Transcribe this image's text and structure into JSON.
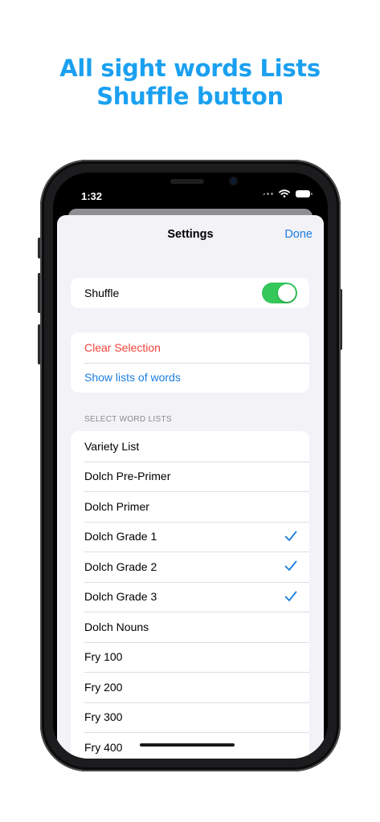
{
  "promo": {
    "line1": "All sight words Lists",
    "line2": "Shuffle button"
  },
  "status_bar": {
    "time": "1:32"
  },
  "settings": {
    "title": "Settings",
    "done_label": "Done",
    "shuffle": {
      "label": "Shuffle",
      "on": true
    },
    "actions": {
      "clear_selection": "Clear Selection",
      "show_lists": "Show lists of words"
    },
    "section_header": "SELECT WORD LISTS",
    "word_lists": [
      {
        "label": "Variety List",
        "checked": false
      },
      {
        "label": "Dolch Pre-Primer",
        "checked": false
      },
      {
        "label": "Dolch Primer",
        "checked": false
      },
      {
        "label": "Dolch Grade 1",
        "checked": true
      },
      {
        "label": "Dolch Grade 2",
        "checked": true
      },
      {
        "label": "Dolch Grade 3",
        "checked": true
      },
      {
        "label": "Dolch Nouns",
        "checked": false
      },
      {
        "label": "Fry 100",
        "checked": false
      },
      {
        "label": "Fry 200",
        "checked": false
      },
      {
        "label": "Fry 300",
        "checked": false
      },
      {
        "label": "Fry 400",
        "checked": false
      }
    ]
  },
  "colors": {
    "promo_blue": "#1aa0f0",
    "ios_blue": "#1b7de0",
    "destructive_red": "#f0433a",
    "toggle_green": "#34c759",
    "grouped_background": "#f2f2f7"
  }
}
